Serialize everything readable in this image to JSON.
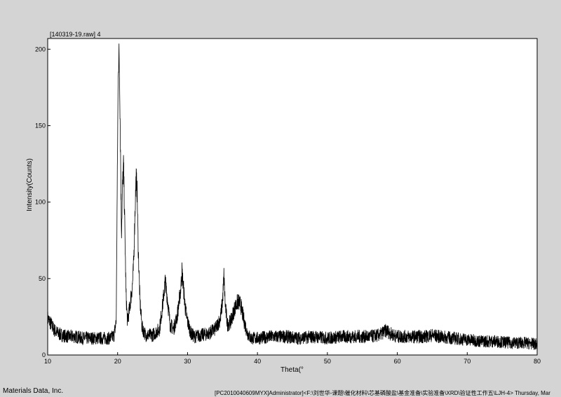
{
  "window": {
    "file_label": "[140319-19.raw] 4",
    "footer_company": "Materials Data, Inc.",
    "footer_path": "[PC2010040609MYX]Administrator]<F:\\刘世华-课题\\催化材料\\芯基磷酸盐\\基金准备\\实验准备\\XRD\\验证性工作五\\LJH-4> Thursday, Mar"
  },
  "colors": {
    "background": "#d4d4d4",
    "plot_area": "#ffffff",
    "trace": "#000000"
  },
  "chart_data": {
    "type": "line",
    "title": "",
    "xlabel": "Theta(°",
    "ylabel": "Intensity(Counts)",
    "xlim": [
      10,
      80
    ],
    "ylim": [
      0,
      207
    ],
    "xticks": [
      10,
      20,
      30,
      40,
      50,
      60,
      70,
      80
    ],
    "yticks": [
      0,
      50,
      100,
      150,
      200
    ],
    "grid": false,
    "legend": "none",
    "series": [
      {
        "points": [
          [
            10.0,
            24
          ],
          [
            10.5,
            20
          ],
          [
            11.0,
            16
          ],
          [
            11.5,
            14
          ],
          [
            12.0,
            13
          ],
          [
            13.0,
            12
          ],
          [
            14.0,
            12
          ],
          [
            15.0,
            11
          ],
          [
            16.0,
            11
          ],
          [
            17.0,
            11
          ],
          [
            18.0,
            11
          ],
          [
            19.0,
            11
          ],
          [
            19.5,
            13
          ],
          [
            19.8,
            22
          ],
          [
            20.0,
            140
          ],
          [
            20.1,
            190
          ],
          [
            20.2,
            196
          ],
          [
            20.3,
            178
          ],
          [
            20.4,
            140
          ],
          [
            20.55,
            80
          ],
          [
            20.7,
            110
          ],
          [
            20.85,
            125
          ],
          [
            21.0,
            90
          ],
          [
            21.2,
            40
          ],
          [
            21.4,
            22
          ],
          [
            21.7,
            30
          ],
          [
            21.9,
            38
          ],
          [
            22.1,
            45
          ],
          [
            22.3,
            60
          ],
          [
            22.5,
            95
          ],
          [
            22.65,
            117
          ],
          [
            22.8,
            106
          ],
          [
            22.95,
            70
          ],
          [
            23.2,
            35
          ],
          [
            23.5,
            18
          ],
          [
            24.0,
            13
          ],
          [
            25.0,
            13
          ],
          [
            26.0,
            17
          ],
          [
            26.5,
            35
          ],
          [
            26.8,
            48
          ],
          [
            27.1,
            38
          ],
          [
            27.5,
            20
          ],
          [
            28.0,
            17
          ],
          [
            28.5,
            25
          ],
          [
            29.0,
            42
          ],
          [
            29.2,
            55
          ],
          [
            29.4,
            45
          ],
          [
            29.7,
            30
          ],
          [
            30.0,
            22
          ],
          [
            30.5,
            14
          ],
          [
            31.0,
            12
          ],
          [
            32.0,
            13
          ],
          [
            33.0,
            14
          ],
          [
            34.0,
            17
          ],
          [
            34.7,
            24
          ],
          [
            35.0,
            35
          ],
          [
            35.2,
            52
          ],
          [
            35.4,
            32
          ],
          [
            35.7,
            20
          ],
          [
            36.2,
            22
          ],
          [
            36.7,
            30
          ],
          [
            37.2,
            35
          ],
          [
            37.6,
            33
          ],
          [
            38.0,
            24
          ],
          [
            38.5,
            15
          ],
          [
            39.0,
            11
          ],
          [
            40.0,
            11
          ],
          [
            42.0,
            12
          ],
          [
            44.0,
            12
          ],
          [
            46.0,
            11
          ],
          [
            48.0,
            12
          ],
          [
            50.0,
            11
          ],
          [
            52.0,
            12
          ],
          [
            54.0,
            12
          ],
          [
            56.0,
            12
          ],
          [
            57.5,
            13
          ],
          [
            58.0,
            15
          ],
          [
            58.5,
            16
          ],
          [
            59.0,
            14
          ],
          [
            60.0,
            12
          ],
          [
            62.0,
            12
          ],
          [
            64.0,
            12
          ],
          [
            65.0,
            13
          ],
          [
            66.0,
            12
          ],
          [
            68.0,
            11
          ],
          [
            70.0,
            10
          ],
          [
            72.0,
            9
          ],
          [
            74.0,
            9
          ],
          [
            76.0,
            8
          ],
          [
            78.0,
            8
          ],
          [
            80.0,
            7
          ]
        ]
      }
    ]
  }
}
